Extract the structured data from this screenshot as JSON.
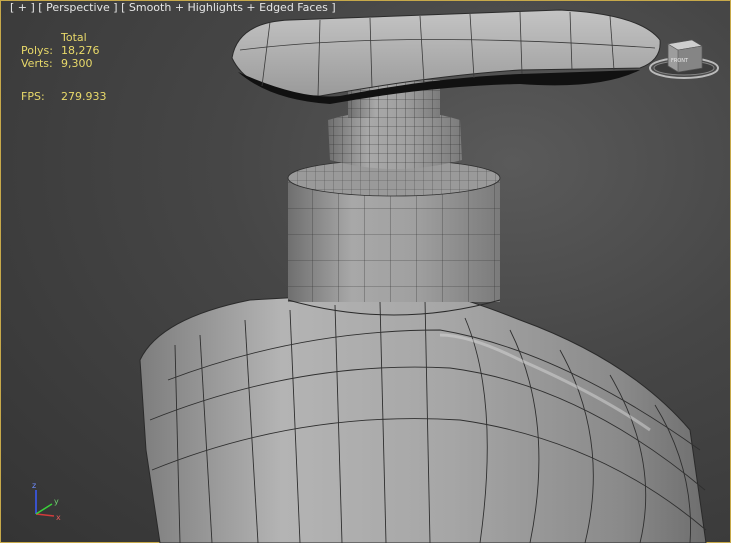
{
  "viewport": {
    "label_plus": "[ + ]",
    "label_view": "[ Perspective ]",
    "label_shading": "[ Smooth + Highlights + Edged Faces ]",
    "border_color": "#c7a94a"
  },
  "stats": {
    "header": "Total",
    "polys_label": "Polys:",
    "polys_value": "18,276",
    "verts_label": "Verts:",
    "verts_value": "9,300",
    "fps_label": "FPS:",
    "fps_value": "279.933",
    "text_color": "#e8d96a"
  },
  "viewcube": {
    "face_label": "FRONT"
  },
  "gizmo": {
    "axes": [
      "x",
      "y",
      "z"
    ]
  }
}
